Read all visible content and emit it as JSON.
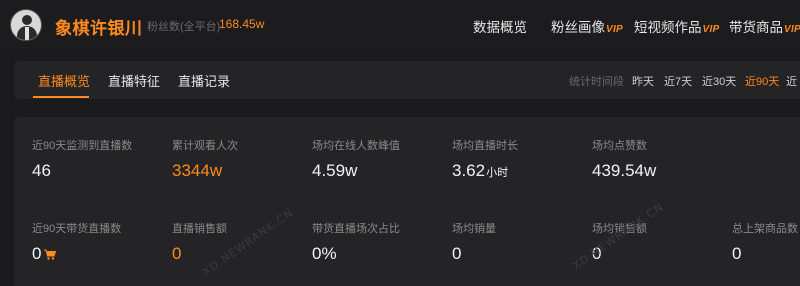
{
  "header": {
    "creator_name": "象棋许银川",
    "fans_label": "粉丝数(全平台)",
    "fans_value": "168.45w",
    "nav": [
      {
        "label": "数据概览",
        "vip": ""
      },
      {
        "label": "粉丝画像",
        "vip": "VIP"
      },
      {
        "label": "短视频作品",
        "vip": "VIP"
      },
      {
        "label": "带货商品",
        "vip": "VIP"
      }
    ]
  },
  "tabs": {
    "items": [
      "直播概览",
      "直播特征",
      "直播记录"
    ],
    "active_index": 0,
    "range_label": "统计时间段",
    "ranges": [
      "昨天",
      "近7天",
      "近30天",
      "近90天",
      "近"
    ],
    "active_range_index": 3
  },
  "stats": {
    "row1": [
      {
        "label": "近90天监测到直播数",
        "value": "46",
        "unit": ""
      },
      {
        "label": "累计观看人次",
        "value": "3344w",
        "unit": "",
        "highlight": true
      },
      {
        "label": "场均在线人数峰值",
        "value": "4.59w",
        "unit": ""
      },
      {
        "label": "场均直播时长",
        "value": "3.62",
        "unit": "小时"
      },
      {
        "label": "场均点赞数",
        "value": "439.54w",
        "unit": ""
      }
    ],
    "row2": [
      {
        "label": "近90天带货直播数",
        "value": "0",
        "icon": "cart-icon"
      },
      {
        "label": "直播销售额",
        "value": "0",
        "highlight": true
      },
      {
        "label": "带货直播场次占比",
        "value": "0%"
      },
      {
        "label": "场均销量",
        "value": "0"
      },
      {
        "label": "场均销售额",
        "value": "0"
      },
      {
        "label": "总上架商品数",
        "value": "0"
      }
    ]
  },
  "watermark": "XD.NEWRANK.CN",
  "colors": {
    "accent": "#ff8a1f",
    "background": "#1b1b1d",
    "card": "#242426"
  }
}
